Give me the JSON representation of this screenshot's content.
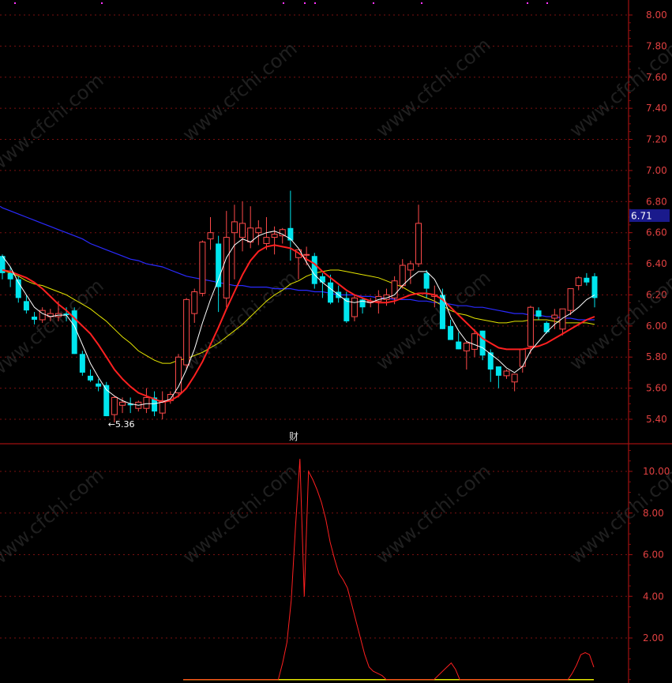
{
  "chart_data": [
    {
      "type": "candlestick",
      "grid": true,
      "ylim": [
        5.3,
        8.1
      ],
      "y_ticks": [
        "8.00",
        "7.80",
        "7.60",
        "7.40",
        "7.20",
        "7.00",
        "6.80",
        "6.60",
        "6.40",
        "6.20",
        "6.00",
        "5.80",
        "5.60",
        "5.40"
      ],
      "current_price": "6.71",
      "low_label": "5.36",
      "marker_text": "财",
      "colors": {
        "up": "#ff4a4a",
        "down": "#00e5ee",
        "ma5": "#ffffff",
        "ma10": "#ff2020",
        "ma20": "#e6e600",
        "ma60": "#2a2aff",
        "tag": "#1a1a8c"
      },
      "candles": [
        [
          6.45,
          6.46,
          6.3,
          6.34
        ],
        [
          6.34,
          6.38,
          6.25,
          6.3
        ],
        [
          6.3,
          6.32,
          6.15,
          6.18
        ],
        [
          6.16,
          6.2,
          6.08,
          6.1
        ],
        [
          6.06,
          6.09,
          6.01,
          6.04
        ],
        [
          6.04,
          6.12,
          6.02,
          6.1
        ],
        [
          6.06,
          6.11,
          6.03,
          6.08
        ],
        [
          6.06,
          6.16,
          6.03,
          6.08
        ],
        [
          6.08,
          6.12,
          6.03,
          6.07
        ],
        [
          6.1,
          6.12,
          5.82,
          5.82
        ],
        [
          5.82,
          5.84,
          5.68,
          5.7
        ],
        [
          5.68,
          5.72,
          5.64,
          5.65
        ],
        [
          5.63,
          5.66,
          5.58,
          5.61
        ],
        [
          5.62,
          5.64,
          5.42,
          5.42
        ],
        [
          5.43,
          5.55,
          5.38,
          5.54
        ],
        [
          5.49,
          5.54,
          5.44,
          5.51
        ],
        [
          5.5,
          5.54,
          5.44,
          5.49
        ],
        [
          5.47,
          5.52,
          5.45,
          5.51
        ],
        [
          5.47,
          5.6,
          5.44,
          5.54
        ],
        [
          5.54,
          5.58,
          5.42,
          5.45
        ],
        [
          5.44,
          5.58,
          5.4,
          5.52
        ],
        [
          5.52,
          5.58,
          5.5,
          5.56
        ],
        [
          5.57,
          5.82,
          5.54,
          5.8
        ],
        [
          5.75,
          6.18,
          5.72,
          6.17
        ],
        [
          6.08,
          6.24,
          6.02,
          6.22
        ],
        [
          6.21,
          6.55,
          6.19,
          6.54
        ],
        [
          6.56,
          6.7,
          6.49,
          6.6
        ],
        [
          6.53,
          6.58,
          6.09,
          6.25
        ],
        [
          6.18,
          6.74,
          6.12,
          6.57
        ],
        [
          6.6,
          6.78,
          6.3,
          6.67
        ],
        [
          6.57,
          6.8,
          6.48,
          6.66
        ],
        [
          6.54,
          6.77,
          6.5,
          6.63
        ],
        [
          6.6,
          6.68,
          6.52,
          6.63
        ],
        [
          6.53,
          6.7,
          6.49,
          6.57
        ],
        [
          6.57,
          6.64,
          6.46,
          6.59
        ],
        [
          6.58,
          6.63,
          6.53,
          6.62
        ],
        [
          6.63,
          6.87,
          6.42,
          6.55
        ],
        [
          6.44,
          6.48,
          6.3,
          6.49
        ],
        [
          6.46,
          6.51,
          6.39,
          6.46
        ],
        [
          6.45,
          6.47,
          6.24,
          6.27
        ],
        [
          6.32,
          6.34,
          6.18,
          6.28
        ],
        [
          6.28,
          6.33,
          6.14,
          6.15
        ],
        [
          6.22,
          6.26,
          6.15,
          6.18
        ],
        [
          6.18,
          6.22,
          6.02,
          6.03
        ],
        [
          6.06,
          6.2,
          6.03,
          6.18
        ],
        [
          6.17,
          6.18,
          6.08,
          6.12
        ],
        [
          6.15,
          6.18,
          6.12,
          6.16
        ],
        [
          6.16,
          6.23,
          6.08,
          6.19
        ],
        [
          6.17,
          6.24,
          6.13,
          6.2
        ],
        [
          6.18,
          6.32,
          6.14,
          6.29
        ],
        [
          6.26,
          6.43,
          6.24,
          6.39
        ],
        [
          6.36,
          6.42,
          6.27,
          6.4
        ],
        [
          6.4,
          6.78,
          6.38,
          6.66
        ],
        [
          6.34,
          6.36,
          6.18,
          6.24
        ],
        [
          6.19,
          6.26,
          6.12,
          6.2
        ],
        [
          6.2,
          6.24,
          5.98,
          5.98
        ],
        [
          6.0,
          6.04,
          5.91,
          5.91
        ],
        [
          5.9,
          5.96,
          5.85,
          5.85
        ],
        [
          5.84,
          5.9,
          5.72,
          5.89
        ],
        [
          5.85,
          5.98,
          5.8,
          5.95
        ],
        [
          5.97,
          5.97,
          5.78,
          5.81
        ],
        [
          5.83,
          5.85,
          5.64,
          5.72
        ],
        [
          5.74,
          5.74,
          5.6,
          5.68
        ],
        [
          5.68,
          5.72,
          5.66,
          5.71
        ],
        [
          5.64,
          5.68,
          5.58,
          5.69
        ],
        [
          5.74,
          5.75,
          5.7,
          5.85
        ],
        [
          5.87,
          6.13,
          5.82,
          6.12
        ],
        [
          6.1,
          6.12,
          6.04,
          6.06
        ],
        [
          6.02,
          6.03,
          5.95,
          5.96
        ],
        [
          6.05,
          6.11,
          5.98,
          6.07
        ],
        [
          5.98,
          6.11,
          5.94,
          6.11
        ],
        [
          6.1,
          6.22,
          6.07,
          6.24
        ],
        [
          6.26,
          6.32,
          6.23,
          6.31
        ],
        [
          6.31,
          6.34,
          6.26,
          6.28
        ],
        [
          6.32,
          6.34,
          6.12,
          6.18
        ]
      ],
      "ma5": [
        6.45,
        6.38,
        6.28,
        6.2,
        6.12,
        6.08,
        6.06,
        6.07,
        6.07,
        6.0,
        5.88,
        5.76,
        5.67,
        5.59,
        5.55,
        5.52,
        5.5,
        5.49,
        5.5,
        5.5,
        5.51,
        5.53,
        5.61,
        5.72,
        5.85,
        6.02,
        6.17,
        6.3,
        6.44,
        6.52,
        6.56,
        6.54,
        6.58,
        6.6,
        6.61,
        6.59,
        6.56,
        6.5,
        6.41,
        6.33,
        6.28,
        6.24,
        6.2,
        6.16,
        6.15,
        6.16,
        6.15,
        6.17,
        6.18,
        6.2,
        6.26,
        6.31,
        6.35,
        6.35,
        6.3,
        6.2,
        6.06,
        5.97,
        5.9,
        5.88,
        5.86,
        5.82,
        5.78,
        5.73,
        5.7,
        5.74,
        5.84,
        5.9,
        5.96,
        6.01,
        6.05,
        6.08,
        6.12,
        6.17,
        6.2
      ],
      "ma10": [
        6.36,
        6.35,
        6.33,
        6.31,
        6.28,
        6.24,
        6.19,
        6.14,
        6.1,
        6.05,
        6.0,
        5.95,
        5.88,
        5.8,
        5.72,
        5.66,
        5.61,
        5.57,
        5.55,
        5.53,
        5.51,
        5.52,
        5.55,
        5.6,
        5.68,
        5.77,
        5.88,
        5.99,
        6.11,
        6.22,
        6.33,
        6.42,
        6.48,
        6.51,
        6.52,
        6.51,
        6.5,
        6.47,
        6.43,
        6.4,
        6.35,
        6.31,
        6.27,
        6.23,
        6.2,
        6.18,
        6.16,
        6.15,
        6.15,
        6.16,
        6.18,
        6.2,
        6.21,
        6.21,
        6.2,
        6.17,
        6.12,
        6.07,
        6.02,
        5.97,
        5.92,
        5.89,
        5.86,
        5.85,
        5.85,
        5.85,
        5.86,
        5.87,
        5.89,
        5.92,
        5.95,
        5.98,
        6.01,
        6.04,
        6.06
      ],
      "ma20": [
        6.36,
        6.34,
        6.32,
        6.29,
        6.27,
        6.26,
        6.24,
        6.22,
        6.2,
        6.17,
        6.14,
        6.11,
        6.07,
        6.03,
        5.98,
        5.93,
        5.89,
        5.84,
        5.81,
        5.78,
        5.76,
        5.76,
        5.78,
        5.79,
        5.81,
        5.83,
        5.86,
        5.89,
        5.93,
        5.97,
        6.01,
        6.06,
        6.11,
        6.16,
        6.2,
        6.23,
        6.27,
        6.29,
        6.32,
        6.34,
        6.35,
        6.36,
        6.36,
        6.35,
        6.34,
        6.33,
        6.32,
        6.31,
        6.29,
        6.27,
        6.25,
        6.22,
        6.2,
        6.18,
        6.16,
        6.13,
        6.1,
        6.08,
        6.07,
        6.05,
        6.04,
        6.03,
        6.02,
        6.02,
        6.03,
        6.03,
        6.04,
        6.04,
        6.04,
        6.03,
        6.02,
        6.02,
        6.02,
        6.02,
        6.01
      ],
      "ma60": [
        6.76,
        6.74,
        6.72,
        6.7,
        6.68,
        6.66,
        6.64,
        6.62,
        6.6,
        6.58,
        6.56,
        6.53,
        6.51,
        6.49,
        6.47,
        6.45,
        6.43,
        6.42,
        6.4,
        6.39,
        6.38,
        6.36,
        6.34,
        6.32,
        6.31,
        6.3,
        6.29,
        6.28,
        6.27,
        6.26,
        6.26,
        6.25,
        6.25,
        6.25,
        6.24,
        6.24,
        6.24,
        6.23,
        6.23,
        6.22,
        6.22,
        6.21,
        6.2,
        6.2,
        6.2,
        6.19,
        6.19,
        6.18,
        6.18,
        6.17,
        6.17,
        6.17,
        6.16,
        6.16,
        6.15,
        6.15,
        6.14,
        6.13,
        6.13,
        6.12,
        6.12,
        6.11,
        6.1,
        6.09,
        6.08,
        6.08,
        6.07,
        6.07,
        6.06,
        6.06,
        6.05,
        6.05,
        6.04,
        6.04,
        6.04
      ]
    },
    {
      "type": "line",
      "grid": true,
      "ylim": [
        0,
        11.3
      ],
      "y_ticks": [
        "10.00",
        "8.00",
        "6.00",
        "4.00",
        "2.00"
      ],
      "colors": {
        "line": "#ff2020",
        "base": "#e6e600"
      },
      "values": [
        0,
        0,
        0,
        0,
        0,
        0,
        0,
        0,
        0,
        0,
        0,
        0,
        0,
        0,
        0,
        0,
        0,
        0,
        0,
        0,
        0,
        0,
        0,
        0.8,
        1.8,
        3.8,
        7.4,
        10.6,
        4.0,
        10.0,
        9.6,
        9.1,
        8.5,
        7.7,
        6.6,
        5.8,
        5.1,
        4.8,
        4.4,
        3.6,
        2.8,
        2.0,
        1.2,
        0.6,
        0.4,
        0.3,
        0.2,
        0,
        0,
        0,
        0,
        0,
        0,
        0,
        0,
        0,
        0,
        0,
        0,
        0.2,
        0.4,
        0.6,
        0.8,
        0.5,
        0,
        0,
        0,
        0,
        0,
        0,
        0,
        0,
        0,
        0,
        0,
        0,
        0,
        0,
        0,
        0,
        0,
        0,
        0,
        0,
        0,
        0,
        0,
        0,
        0,
        0,
        0.3,
        0.7,
        1.2,
        1.3,
        1.2,
        0.6
      ]
    }
  ]
}
